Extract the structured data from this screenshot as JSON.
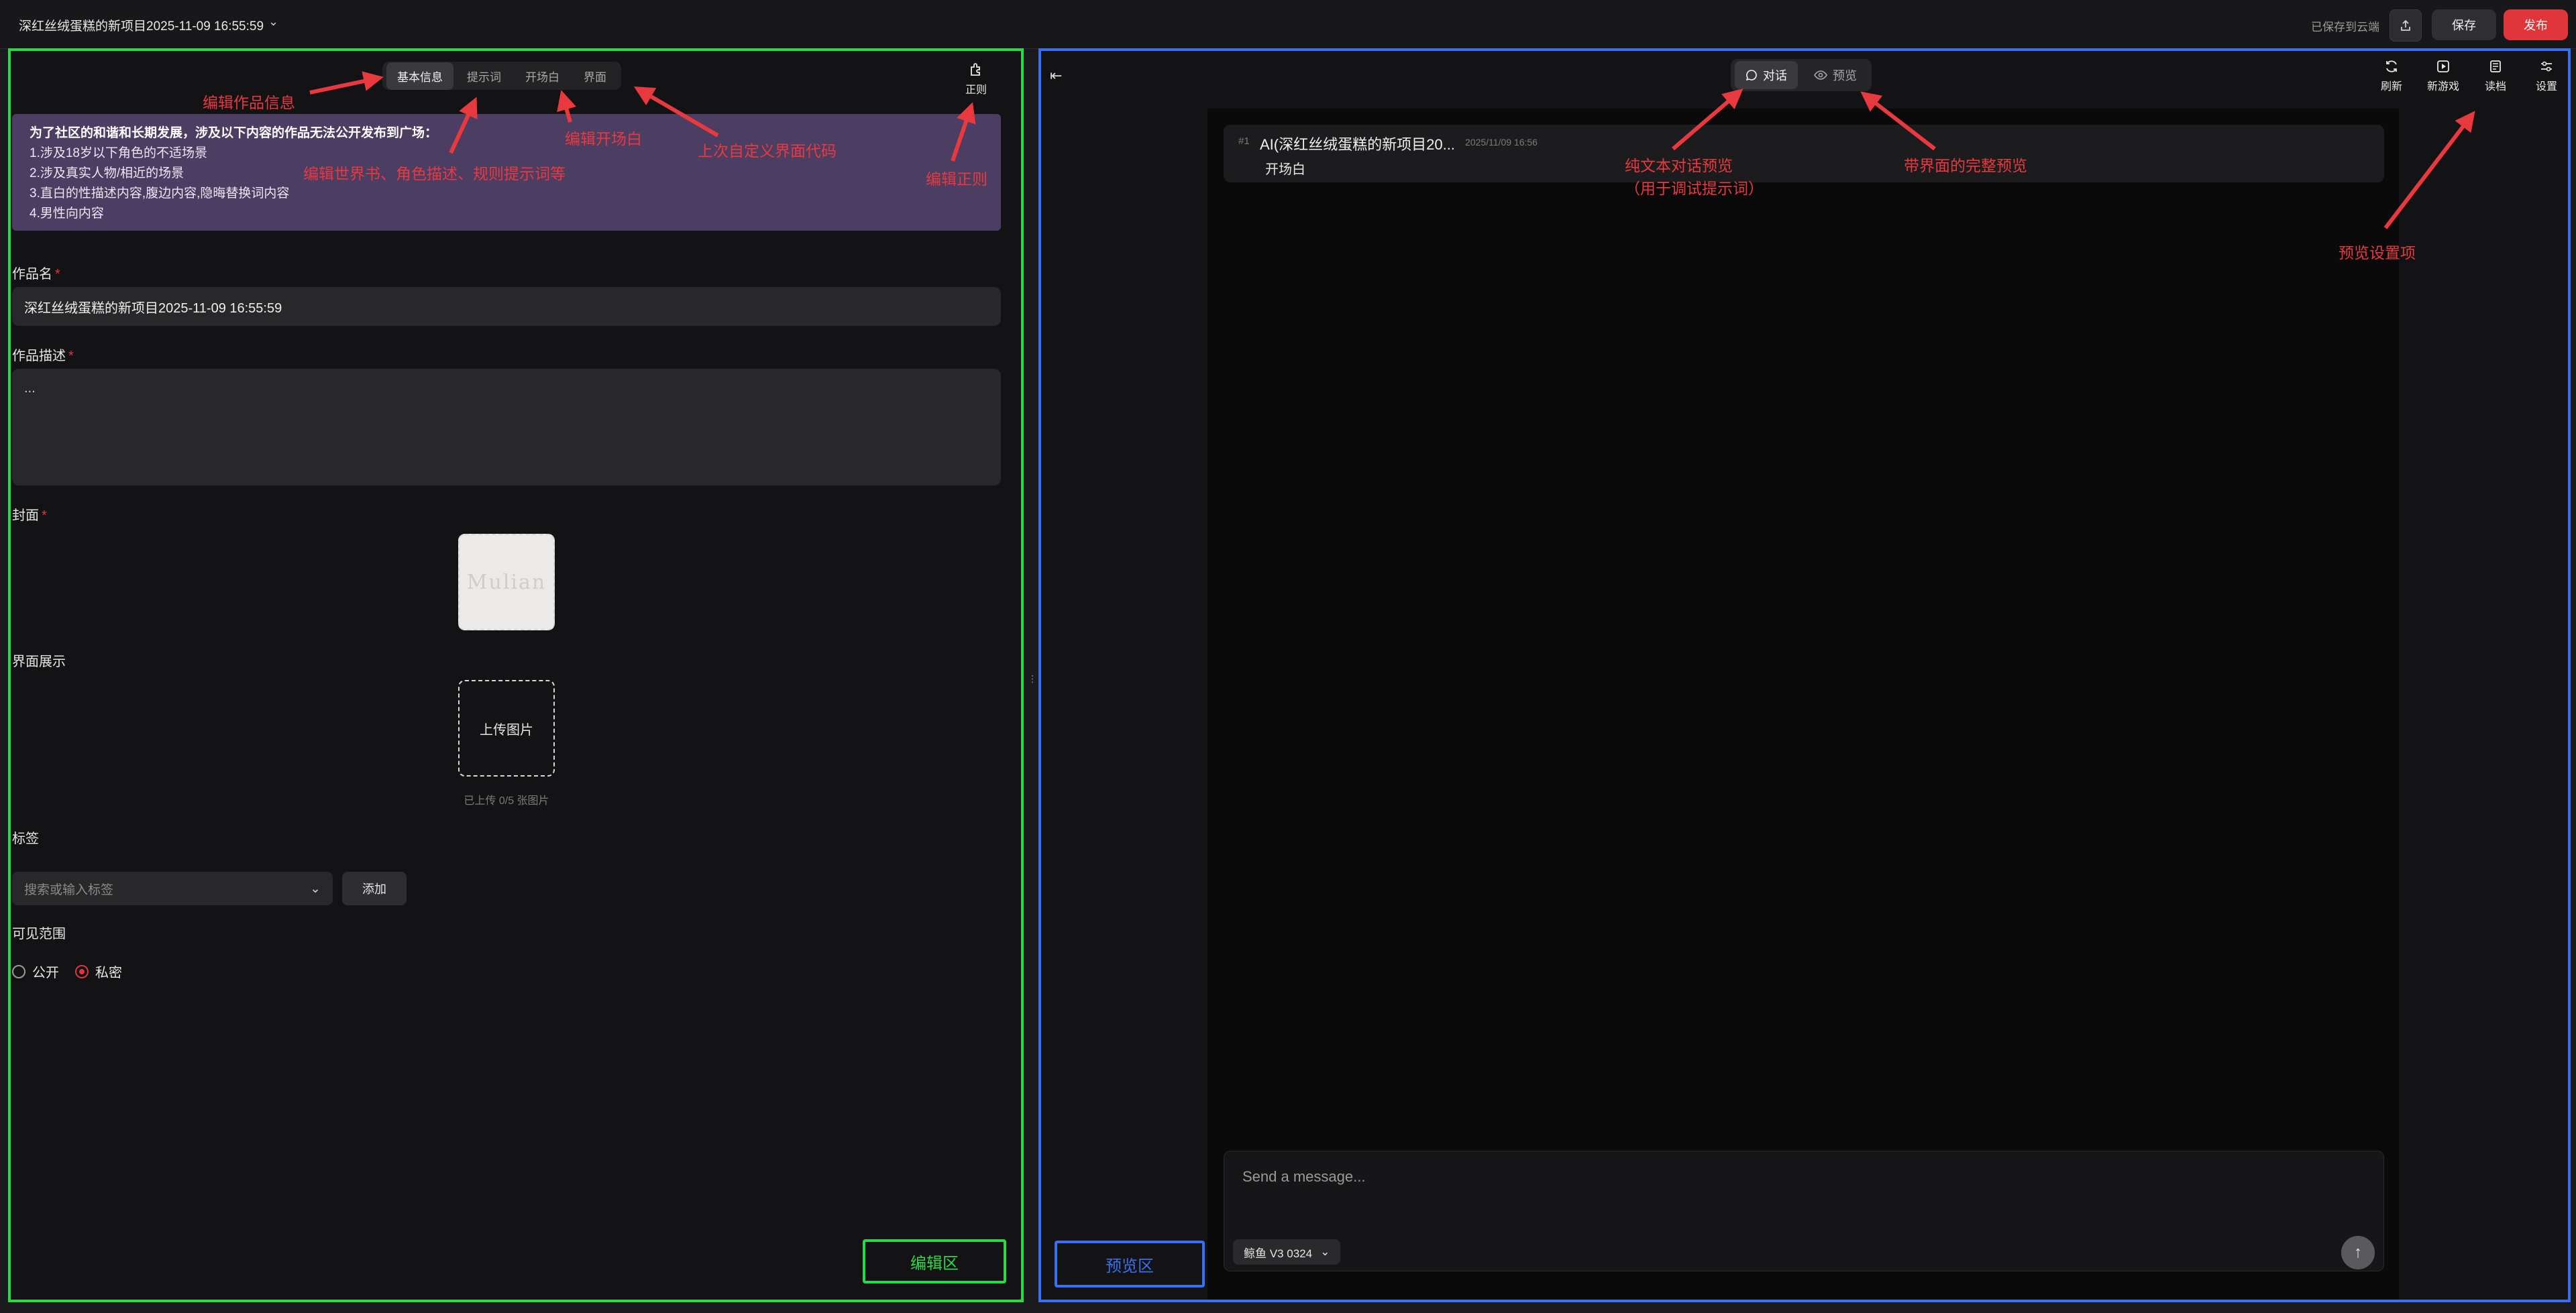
{
  "topbar": {
    "project_title": "深红丝绒蛋糕的新项目2025-11-09 16:55:59",
    "saved_status": "已保存到云端",
    "save_label": "保存",
    "publish_label": "发布"
  },
  "editor": {
    "tabs": [
      {
        "label": "基本信息",
        "active": true
      },
      {
        "label": "提示词",
        "active": false
      },
      {
        "label": "开场白",
        "active": false
      },
      {
        "label": "界面",
        "active": false
      }
    ],
    "regex_label": "正则",
    "notice": {
      "head": "为了社区的和谐和长期发展，涉及以下内容的作品无法公开发布到广场：",
      "lines": [
        "1.涉及18岁以下角色的不适场景",
        "2.涉及真实人物/相近的场景",
        "3.直白的性描述内容,腹边内容,隐晦替换词内容",
        "4.男性向内容"
      ]
    },
    "name_label": "作品名",
    "name_value": "深红丝绒蛋糕的新项目2025-11-09 16:55:59",
    "desc_label": "作品描述",
    "desc_value": "...",
    "cover_label": "封面",
    "cover_logo_text": "Mulian",
    "ui_label": "界面展示",
    "upload_label": "上传图片",
    "upload_count": "已上传 0/5 张图片",
    "tags_label": "标签",
    "tags_placeholder": "搜索或输入标签",
    "tags_add": "添加",
    "visibility_label": "可见范围",
    "visibility_options": [
      {
        "label": "公开",
        "selected": false
      },
      {
        "label": "私密",
        "selected": true
      }
    ],
    "zone_label": "编辑区"
  },
  "preview": {
    "tabs": [
      {
        "label": "对话",
        "icon": "chat-bubble-icon",
        "active": true
      },
      {
        "label": "预览",
        "icon": "eye-icon",
        "active": false
      }
    ],
    "tools": [
      {
        "label": "刷新",
        "icon": "refresh-icon"
      },
      {
        "label": "新游戏",
        "icon": "play-square-icon"
      },
      {
        "label": "读档",
        "icon": "book-icon"
      },
      {
        "label": "设置",
        "icon": "sliders-icon"
      }
    ],
    "message": {
      "index": "#1",
      "name": "AI(深红丝绒蛋糕的新项目20...",
      "time": "2025/11/09 16:56",
      "body": "开场白"
    },
    "input_placeholder": "Send a message...",
    "model": "鲸鱼 V3 0324",
    "zone_label": "预览区"
  },
  "annotations": {
    "edit_info": "编辑作品信息",
    "edit_prompt": "编辑世界书、角色描述、规则提示词等",
    "edit_opening": "编辑开场白",
    "upload_ui": "上次自定义界面代码",
    "edit_regex": "编辑正则",
    "text_preview_1": "纯文本对话预览",
    "text_preview_2": "（用于调试提示词）",
    "full_preview": "带界面的完整预览",
    "preview_settings": "预览设置项"
  },
  "colors": {
    "edit_zone": "#2fd645",
    "preview_zone": "#3a6ff0",
    "accent_red": "#e0353b",
    "notice_bg": "#4c3d63"
  }
}
